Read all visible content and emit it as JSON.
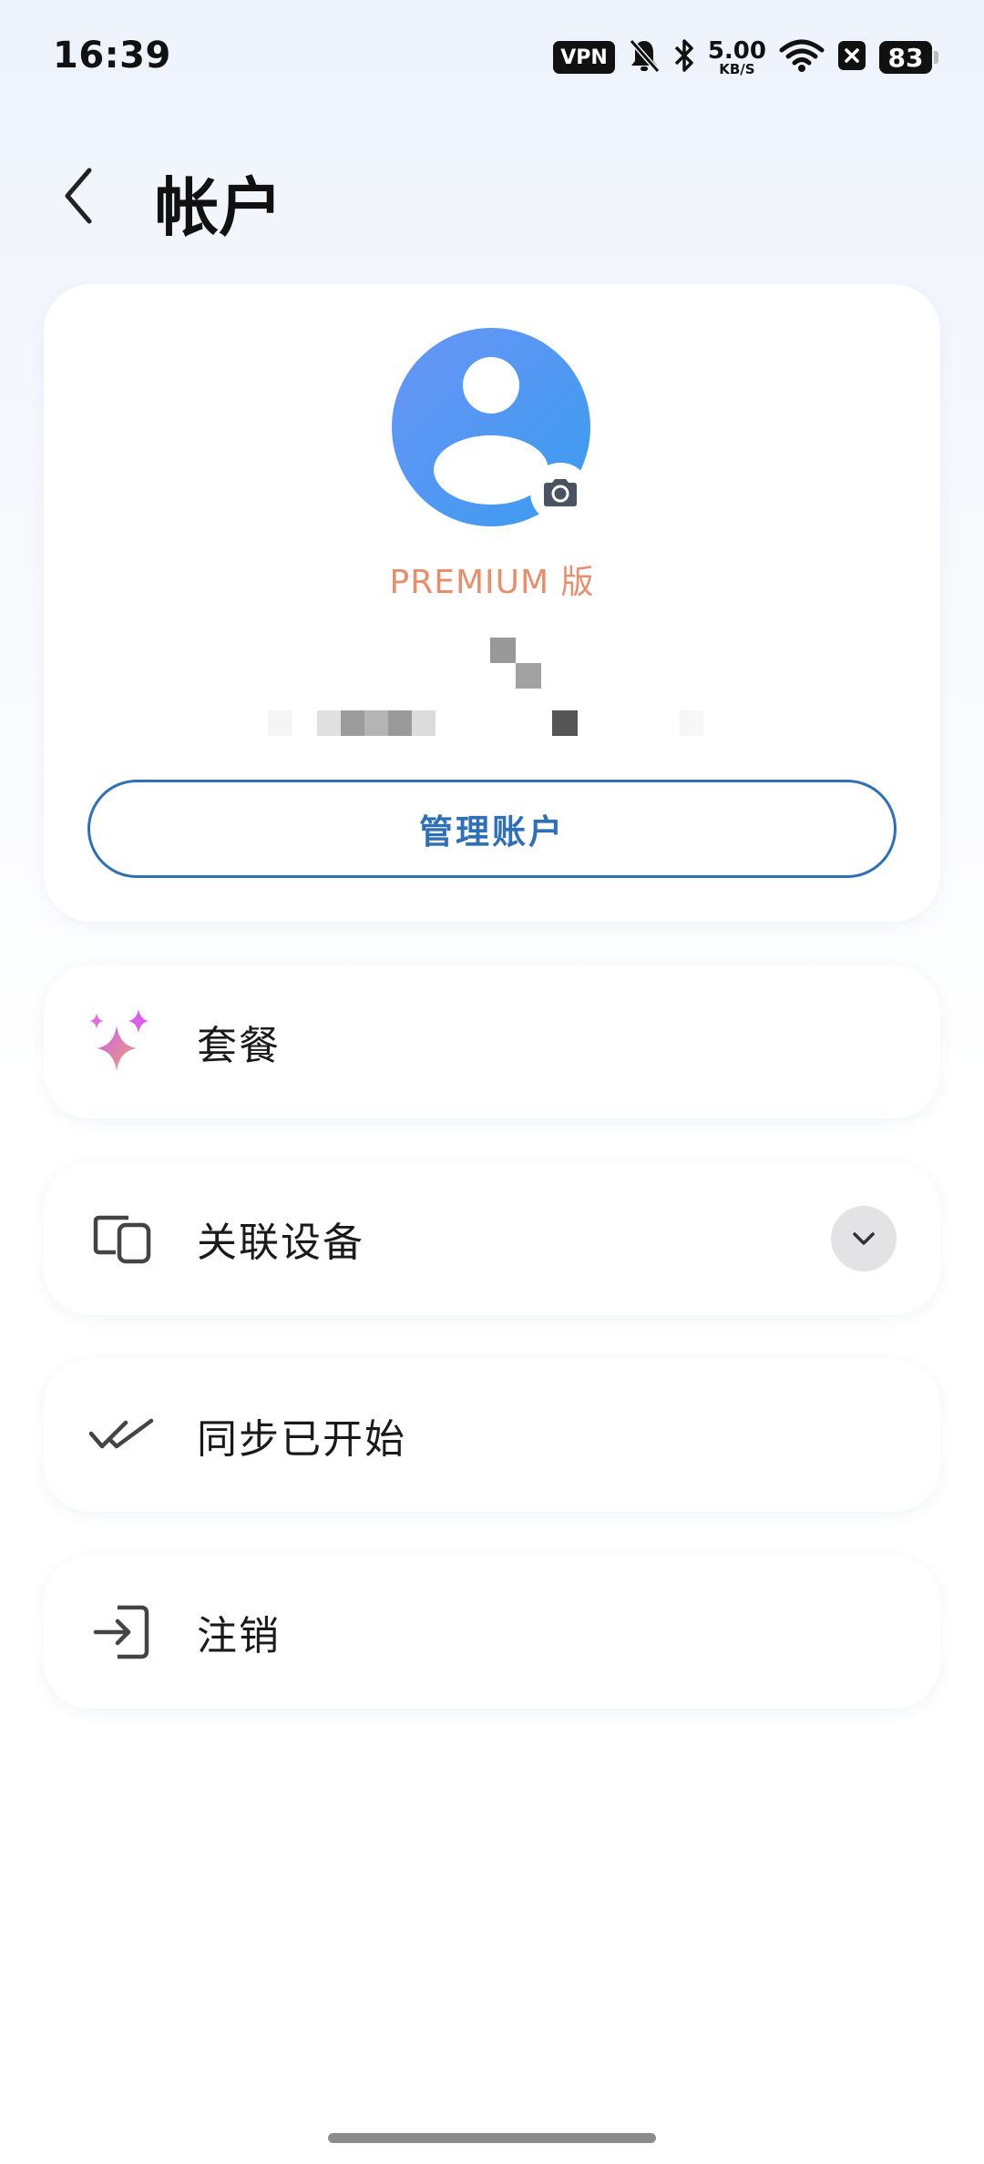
{
  "status_bar": {
    "time": "16:39",
    "vpn": "VPN",
    "net_speed_value": "5.00",
    "net_speed_unit": "KB/S",
    "battery": "83",
    "icons": [
      "vpn-icon",
      "bell-muted-icon",
      "bluetooth-icon",
      "wifi-icon",
      "close-box-icon",
      "battery-icon"
    ]
  },
  "header": {
    "title": "帐户",
    "back_icon": "chevron-left-icon"
  },
  "profile": {
    "tier_label": "PREMIUM 版",
    "avatar_icon": "person-icon",
    "camera_icon": "camera-icon",
    "manage_button": "管理账户"
  },
  "menu": {
    "items": [
      {
        "label": "套餐",
        "icon": "sparkle-icon"
      },
      {
        "label": "关联设备",
        "icon": "devices-icon",
        "expand_icon": "chevron-down-icon"
      },
      {
        "label": "同步已开始",
        "icon": "double-check-icon"
      },
      {
        "label": "注销",
        "icon": "sign-in-icon"
      }
    ]
  },
  "colors": {
    "accent": "#2f6fb3",
    "premium": "#e58f6e",
    "avatar_gradient_start": "#6a95f6",
    "avatar_gradient_end": "#3a9cef"
  }
}
